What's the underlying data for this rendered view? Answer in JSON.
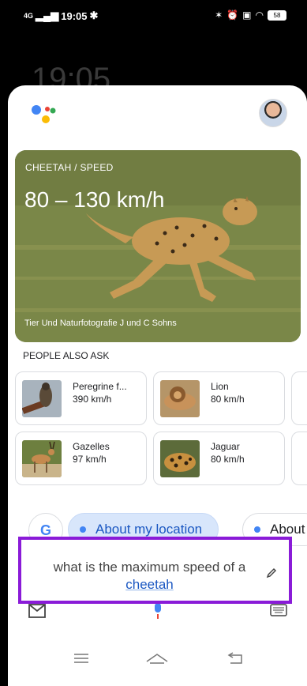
{
  "status_bar": {
    "time": "19:05",
    "network": "4G",
    "battery": "58"
  },
  "background_clock": "19:05",
  "hero": {
    "topic": "CHEETAH / SPEED",
    "value": "80 – 130 km/h",
    "credit": "Tier Und Naturfotografie J und C Sohns"
  },
  "people_also_ask": {
    "title": "PEOPLE ALSO ASK",
    "items": [
      {
        "name": "Peregrine f...",
        "speed": "390 km/h",
        "icon": "falcon-image"
      },
      {
        "name": "Lion",
        "speed": "80 km/h",
        "icon": "lion-image"
      },
      {
        "name": "Gazelles",
        "speed": "97 km/h",
        "icon": "gazelle-image"
      },
      {
        "name": "Jaguar",
        "speed": "80 km/h",
        "icon": "jaguar-image"
      }
    ]
  },
  "chips": {
    "google": "G",
    "chip1": "About my location",
    "chip2": "About"
  },
  "query": {
    "text": "what is the maximum speed of a",
    "highlight": "cheetah"
  },
  "colors": {
    "accent": "#1a57c2",
    "highlight_box": "#8a1bd8",
    "chip_bg": "#d8e6fb"
  }
}
